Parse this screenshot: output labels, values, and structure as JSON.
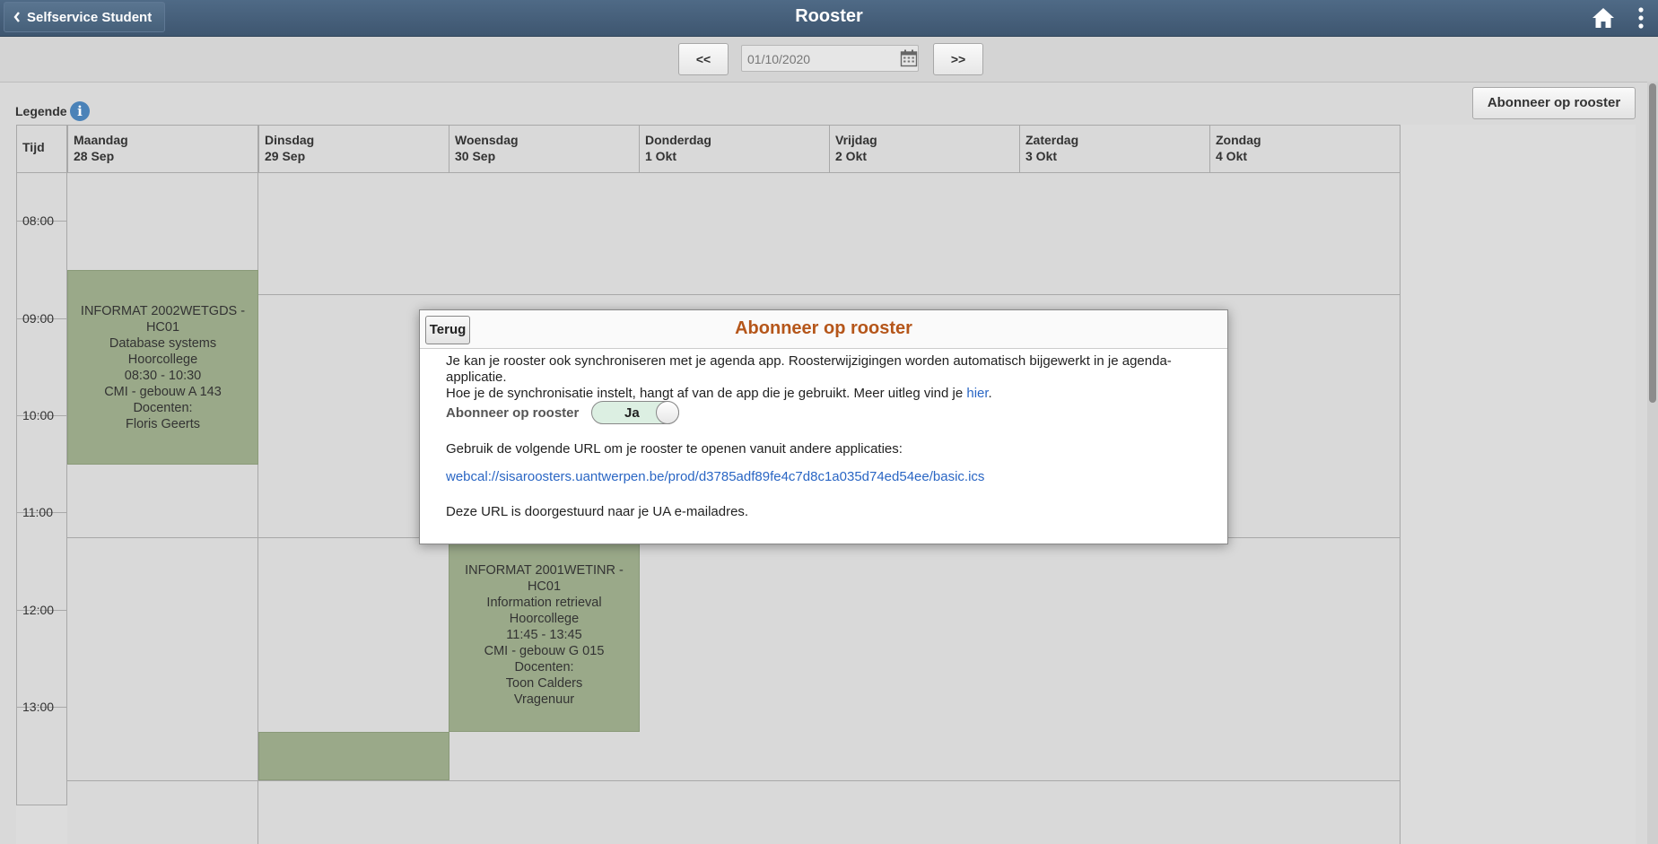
{
  "topbar": {
    "back_label": "Selfservice Student",
    "title": "Rooster"
  },
  "datebar": {
    "prev_label": "<<",
    "next_label": ">>",
    "date_value": "01/10/2020"
  },
  "legend": {
    "label": "Legende",
    "info_glyph": "i"
  },
  "subscribe_button": "Abonneer op rooster",
  "schedule": {
    "time_header": "Tijd",
    "days": [
      {
        "name": "Maandag",
        "date": "28 Sep"
      },
      {
        "name": "Dinsdag",
        "date": "29 Sep"
      },
      {
        "name": "Woensdag",
        "date": "30 Sep"
      },
      {
        "name": "Donderdag",
        "date": "1 Okt"
      },
      {
        "name": "Vrijdag",
        "date": "2 Okt"
      },
      {
        "name": "Zaterdag",
        "date": "3 Okt"
      },
      {
        "name": "Zondag",
        "date": "4 Okt"
      }
    ],
    "times": [
      "08:00",
      "09:00",
      "10:00",
      "11:00",
      "12:00",
      "13:00"
    ],
    "events": [
      {
        "day": 0,
        "lines": [
          "INFORMAT 2002WETGDS - HC01",
          "Database systems",
          "Hoorcollege",
          "08:30 - 10:30",
          "CMI - gebouw A 143",
          "Docenten:",
          "Floris Geerts"
        ]
      },
      {
        "day": 2,
        "lines": [
          "INFORMAT 2001WETINR - HC01",
          "Information retrieval",
          "Hoorcollege",
          "11:45 - 13:45",
          "CMI - gebouw G 015",
          "Docenten:",
          "Toon Calders",
          "Vragenuur"
        ]
      }
    ]
  },
  "modal": {
    "back_label": "Terug",
    "title": "Abonneer op rooster",
    "intro_line1": "Je kan je rooster ook synchroniseren met je agenda app. Roosterwijzigingen worden automatisch bijgewerkt in je agenda-applicatie.",
    "intro_line2": "Hoe je de synchronisatie instelt, hangt af van de app die je gebruikt. Meer uitleg vind je",
    "intro_link": "hier",
    "intro_end": ".",
    "toggle_label": "Abonneer op rooster",
    "toggle_value": "Ja",
    "url_label": "Gebruik de volgende URL om je rooster te openen vanuit andere applicaties:",
    "url": "webcal://sisaroosters.uantwerpen.be/prod/d3785adf89fe4c7d8c1a035d74ed54ee/basic.ics",
    "mail_note": "Deze URL is doorgestuurd naar je UA e-mailadres."
  },
  "colors": {
    "topbar": "#46607a",
    "event": "#9aa989",
    "modal_title": "#b5561a",
    "link": "#2a66c4"
  }
}
